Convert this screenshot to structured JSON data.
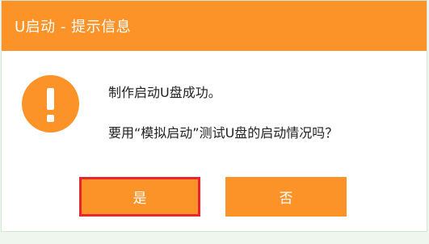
{
  "dialog": {
    "title": "U启动 - 提示信息",
    "message_line1": "制作启动U盘成功。",
    "message_line2": "要用“模拟启动”测试U盘的启动情况吗？",
    "icon": "exclamation-icon",
    "accent_color": "#fb9329",
    "highlight_color": "#e8262d"
  },
  "buttons": {
    "yes_label": "是",
    "no_label": "否"
  }
}
